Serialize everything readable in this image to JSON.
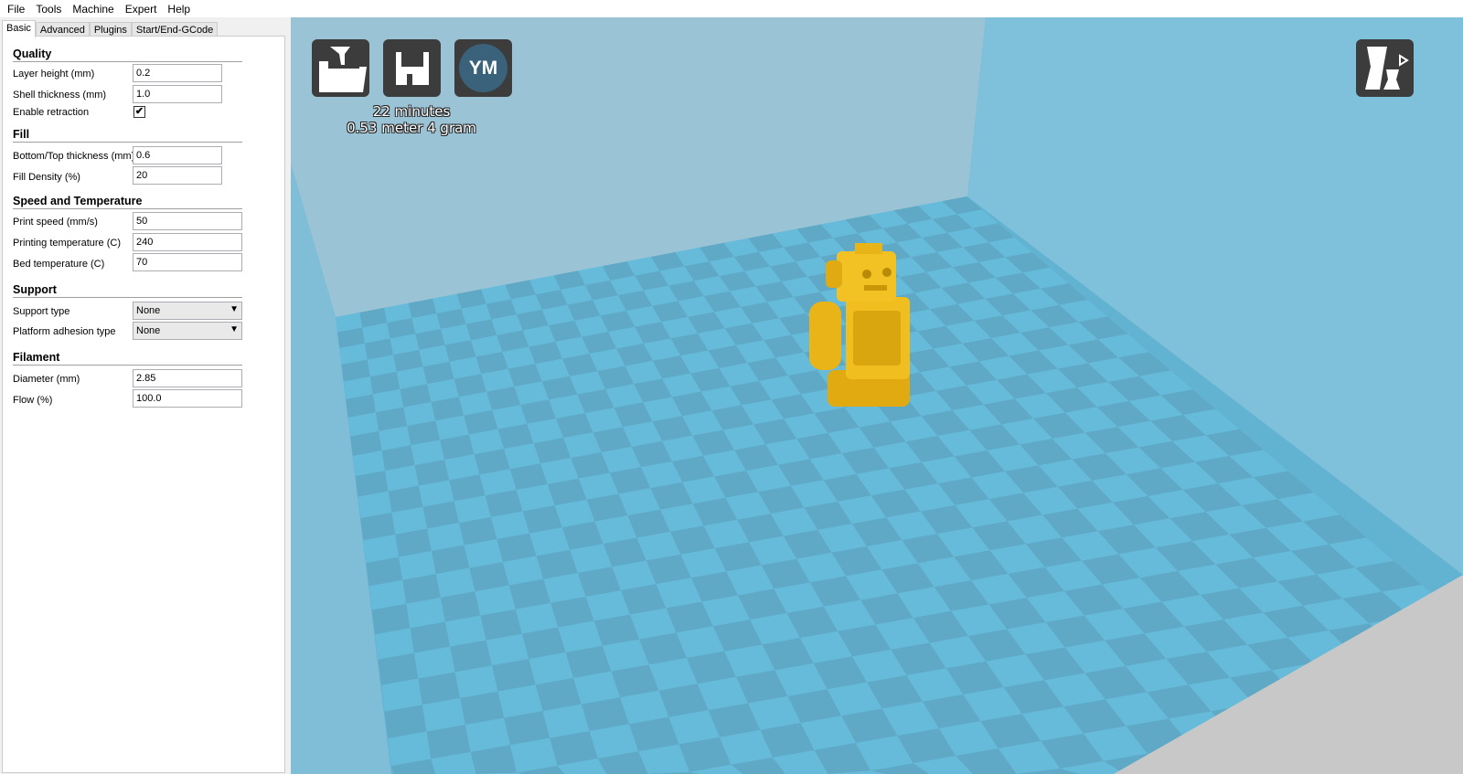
{
  "menu": [
    "File",
    "Tools",
    "Machine",
    "Expert",
    "Help"
  ],
  "tabs": [
    "Basic",
    "Advanced",
    "Plugins",
    "Start/End-GCode"
  ],
  "quality": {
    "title": "Quality",
    "layer_height_label": "Layer height (mm)",
    "layer_height": "0.2",
    "shell_label": "Shell thickness (mm)",
    "shell": "1.0",
    "retraction_label": "Enable retraction",
    "retraction": true
  },
  "fill": {
    "title": "Fill",
    "bt_label": "Bottom/Top thickness (mm)",
    "bt": "0.6",
    "density_label": "Fill Density (%)",
    "density": "20"
  },
  "speed": {
    "title": "Speed and Temperature",
    "speed_label": "Print speed (mm/s)",
    "speed": "50",
    "temp_label": "Printing temperature (C)",
    "temp": "240",
    "bed_label": "Bed temperature (C)",
    "bed": "70"
  },
  "support": {
    "title": "Support",
    "type_label": "Support type",
    "type": "None",
    "adhesion_label": "Platform adhesion type",
    "adhesion": "None"
  },
  "filament": {
    "title": "Filament",
    "diameter_label": "Diameter (mm)",
    "diameter": "2.85",
    "flow_label": "Flow (%)",
    "flow": "100.0"
  },
  "viewer": {
    "ym_label": "YM",
    "print_time": "22 minutes",
    "material": "0.53 meter 4 gram",
    "icons": [
      "load-icon",
      "save-icon",
      "youmagine-icon",
      "view-mode-icon"
    ],
    "colors": {
      "floor_light": "#66bbdb",
      "floor_dark": "#5fa9c6",
      "model": "#f0be1e"
    }
  }
}
